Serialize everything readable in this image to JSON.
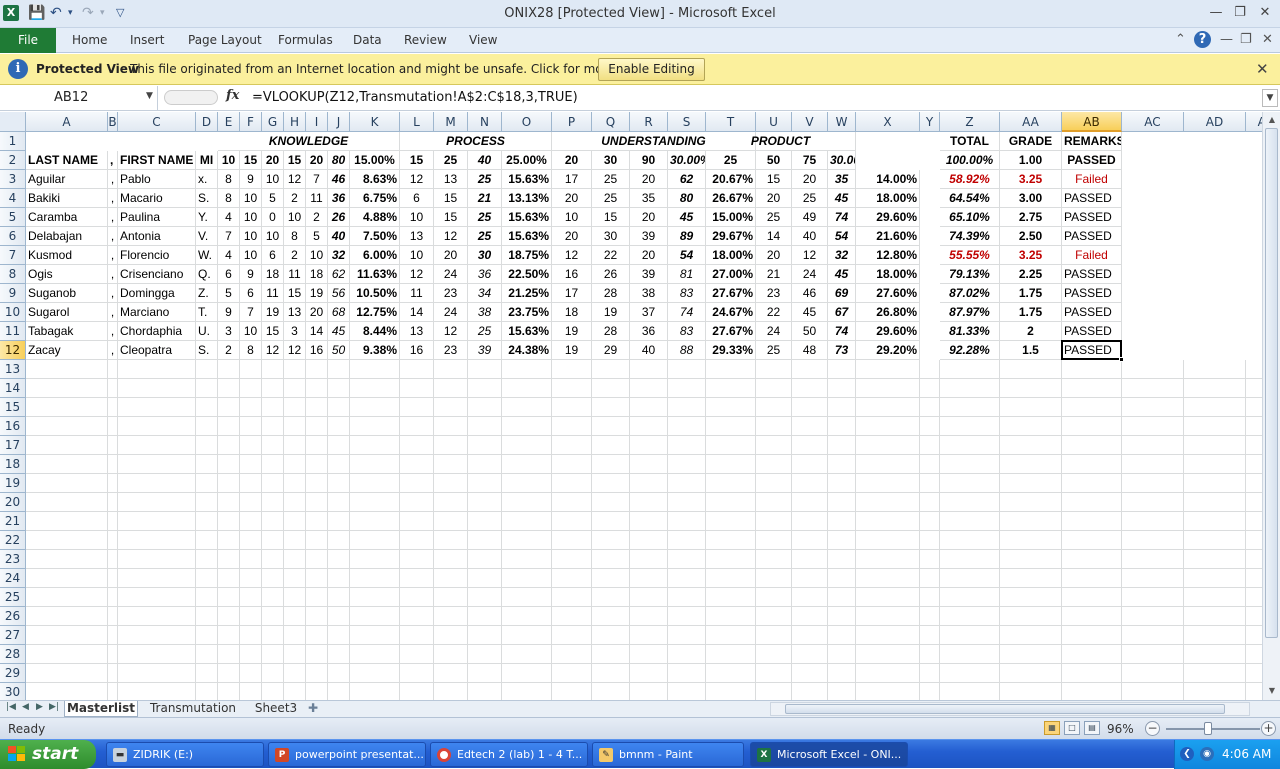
{
  "window": {
    "title": "ONIX28  [Protected View] - Microsoft Excel",
    "app_icon": "X"
  },
  "ribbon": {
    "file_label": "File",
    "tabs": [
      "Home",
      "Insert",
      "Page Layout",
      "Formulas",
      "Data",
      "Review",
      "View"
    ]
  },
  "protected_view": {
    "title": "Protected View",
    "message": "This file originated from an Internet location and might be unsafe. Click for more details.",
    "enable_button": "Enable Editing"
  },
  "formula_bar": {
    "name_box": "AB12",
    "formula": "=VLOOKUP(Z12,Transmutation!A$2:C$18,3,TRUE)"
  },
  "grid": {
    "active_cell": "AB12",
    "selected_column": "AB",
    "selected_row": "12",
    "columns": [
      "A",
      "B",
      "C",
      "D",
      "E",
      "F",
      "G",
      "H",
      "I",
      "J",
      "K",
      "L",
      "M",
      "N",
      "O",
      "P",
      "Q",
      "R",
      "S",
      "T",
      "U",
      "V",
      "W",
      "X",
      "Y",
      "Z",
      "AA",
      "AB",
      "AC",
      "AD",
      "AE"
    ],
    "row_numbers": [
      "1",
      "2",
      "3",
      "4",
      "5",
      "6",
      "7",
      "8",
      "9",
      "10",
      "11",
      "12",
      "13",
      "14",
      "15",
      "16",
      "17",
      "18",
      "19",
      "20",
      "21",
      "22",
      "23",
      "24",
      "25",
      "26",
      "27",
      "28",
      "29",
      "30"
    ],
    "section_headers": [
      {
        "text": "KNOWLEDGE"
      },
      {
        "text": "PROCESS"
      },
      {
        "text": "UNDERSTANDING"
      },
      {
        "text": "PRODUCT"
      },
      {
        "text": "TOTAL"
      },
      {
        "text": "GRADE"
      },
      {
        "text": "REMARKS"
      }
    ],
    "header_row": [
      "LAST NAME",
      ",",
      "FIRST NAME",
      "MI",
      "10",
      "15",
      "20",
      "15",
      "20",
      "80",
      "15.00%",
      "15",
      "25",
      "40",
      "25.00%",
      "20",
      "30",
      "90",
      "30.00%",
      "25",
      "50",
      "75",
      "30.00%",
      "",
      "100.00%",
      "1.00",
      "PASSED"
    ],
    "rows": [
      {
        "cells": [
          "Aguilar",
          ",",
          "Pablo",
          "x.",
          "8",
          "9",
          "10",
          "12",
          "7",
          "46",
          "8.63%",
          "12",
          "13",
          "25",
          "15.63%",
          "17",
          "25",
          "20",
          "62",
          "20.67%",
          "15",
          "20",
          "35",
          "14.00%",
          "58.92%",
          "3.25",
          "Failed"
        ],
        "failed": true
      },
      {
        "cells": [
          "Bakiki",
          ",",
          "Macario",
          "S.",
          "8",
          "10",
          "5",
          "2",
          "11",
          "36",
          "6.75%",
          "6",
          "15",
          "21",
          "13.13%",
          "20",
          "25",
          "35",
          "80",
          "26.67%",
          "20",
          "25",
          "45",
          "18.00%",
          "64.54%",
          "3.00",
          "PASSED"
        ],
        "failed": false
      },
      {
        "cells": [
          "Caramba",
          ",",
          "Paulina",
          "Y.",
          "4",
          "10",
          "0",
          "10",
          "2",
          "26",
          "4.88%",
          "10",
          "15",
          "25",
          "15.63%",
          "10",
          "15",
          "20",
          "45",
          "15.00%",
          "25",
          "49",
          "74",
          "29.60%",
          "65.10%",
          "2.75",
          "PASSED"
        ],
        "failed": false
      },
      {
        "cells": [
          "Delabajan",
          ",",
          "Antonia",
          "V.",
          "7",
          "10",
          "10",
          "8",
          "5",
          "40",
          "7.50%",
          "13",
          "12",
          "25",
          "15.63%",
          "20",
          "30",
          "39",
          "89",
          "29.67%",
          "14",
          "40",
          "54",
          "21.60%",
          "74.39%",
          "2.50",
          "PASSED"
        ],
        "failed": false
      },
      {
        "cells": [
          "Kusmod",
          ",",
          "Florencio",
          "W.",
          "4",
          "10",
          "6",
          "2",
          "10",
          "32",
          "6.00%",
          "10",
          "20",
          "30",
          "18.75%",
          "12",
          "22",
          "20",
          "54",
          "18.00%",
          "20",
          "12",
          "32",
          "12.80%",
          "55.55%",
          "3.25",
          "Failed"
        ],
        "failed": true
      },
      {
        "cells": [
          "Ogis",
          ",",
          "Crisenciano",
          "Q.",
          "6",
          "9",
          "18",
          "11",
          "18",
          "62",
          "11.63%",
          "12",
          "24",
          "36",
          "22.50%",
          "16",
          "26",
          "39",
          "81",
          "27.00%",
          "21",
          "24",
          "45",
          "18.00%",
          "79.13%",
          "2.25",
          "PASSED"
        ],
        "failed": false
      },
      {
        "cells": [
          "Suganob",
          ",",
          "Domingga",
          "Z.",
          "5",
          "6",
          "11",
          "15",
          "19",
          "56",
          "10.50%",
          "11",
          "23",
          "34",
          "21.25%",
          "17",
          "28",
          "38",
          "83",
          "27.67%",
          "23",
          "46",
          "69",
          "27.60%",
          "87.02%",
          "1.75",
          "PASSED"
        ],
        "failed": false
      },
      {
        "cells": [
          "Sugarol",
          ",",
          "Marciano",
          "T.",
          "9",
          "7",
          "19",
          "13",
          "20",
          "68",
          "12.75%",
          "14",
          "24",
          "38",
          "23.75%",
          "18",
          "19",
          "37",
          "74",
          "24.67%",
          "22",
          "45",
          "67",
          "26.80%",
          "87.97%",
          "1.75",
          "PASSED"
        ],
        "failed": false
      },
      {
        "cells": [
          "Tabagak",
          ",",
          "Chordaphia",
          "U.",
          "3",
          "10",
          "15",
          "3",
          "14",
          "45",
          "8.44%",
          "13",
          "12",
          "25",
          "15.63%",
          "19",
          "28",
          "36",
          "83",
          "27.67%",
          "24",
          "50",
          "74",
          "29.60%",
          "81.33%",
          "2",
          "PASSED"
        ],
        "failed": false
      },
      {
        "cells": [
          "Zacay",
          ",",
          "Cleopatra",
          "S.",
          "2",
          "8",
          "12",
          "12",
          "16",
          "50",
          "9.38%",
          "16",
          "23",
          "39",
          "24.38%",
          "19",
          "29",
          "40",
          "88",
          "29.33%",
          "25",
          "48",
          "73",
          "29.20%",
          "92.28%",
          "1.5",
          "PASSED"
        ],
        "failed": false
      }
    ]
  },
  "sheets": {
    "tabs": [
      "Masterlist",
      "Transmutation",
      "Sheet3"
    ],
    "active": "Masterlist"
  },
  "status": {
    "text": "Ready",
    "zoom": "96%"
  },
  "taskbar": {
    "start": "start",
    "items": [
      "ZIDRIK (E:)",
      "powerpoint presentat...",
      "Edtech 2 (lab) 1 - 4 T...",
      "bmnm - Paint",
      "Microsoft Excel - ONI..."
    ],
    "clock": "4:06 AM"
  },
  "colors": {
    "failed": "#c00000",
    "selection": "#f8cf5a",
    "file_tab": "#1f7b35",
    "protected_bar": "#fbf09d"
  }
}
